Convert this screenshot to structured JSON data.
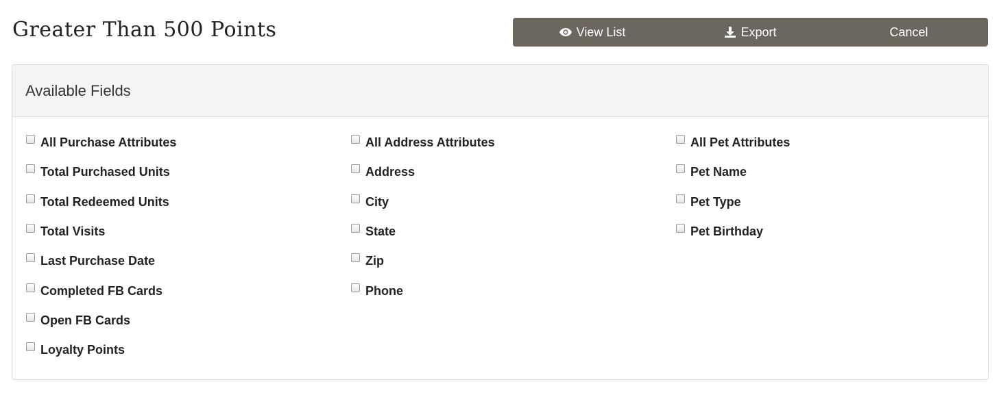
{
  "page": {
    "title": "Greater Than 500 Points"
  },
  "toolbar": {
    "view_list_label": "View List",
    "export_label": "Export",
    "cancel_label": "Cancel",
    "background_color": "#6b665e"
  },
  "panel": {
    "title": "Available Fields",
    "columns": [
      {
        "fields": [
          {
            "label": "All Purchase Attributes",
            "checked": false
          },
          {
            "label": "Total Purchased Units",
            "checked": false
          },
          {
            "label": "Total Redeemed Units",
            "checked": false
          },
          {
            "label": "Total Visits",
            "checked": false
          },
          {
            "label": "Last Purchase Date",
            "checked": false
          },
          {
            "label": "Completed FB Cards",
            "checked": false
          },
          {
            "label": "Open FB Cards",
            "checked": false
          },
          {
            "label": "Loyalty Points",
            "checked": false
          }
        ]
      },
      {
        "fields": [
          {
            "label": "All Address Attributes",
            "checked": false
          },
          {
            "label": "Address",
            "checked": false
          },
          {
            "label": "City",
            "checked": false
          },
          {
            "label": "State",
            "checked": false
          },
          {
            "label": "Zip",
            "checked": false
          },
          {
            "label": "Phone",
            "checked": false
          }
        ]
      },
      {
        "fields": [
          {
            "label": "All Pet Attributes",
            "checked": false
          },
          {
            "label": "Pet Name",
            "checked": false
          },
          {
            "label": "Pet Type",
            "checked": false
          },
          {
            "label": "Pet Birthday",
            "checked": false
          }
        ]
      }
    ]
  }
}
